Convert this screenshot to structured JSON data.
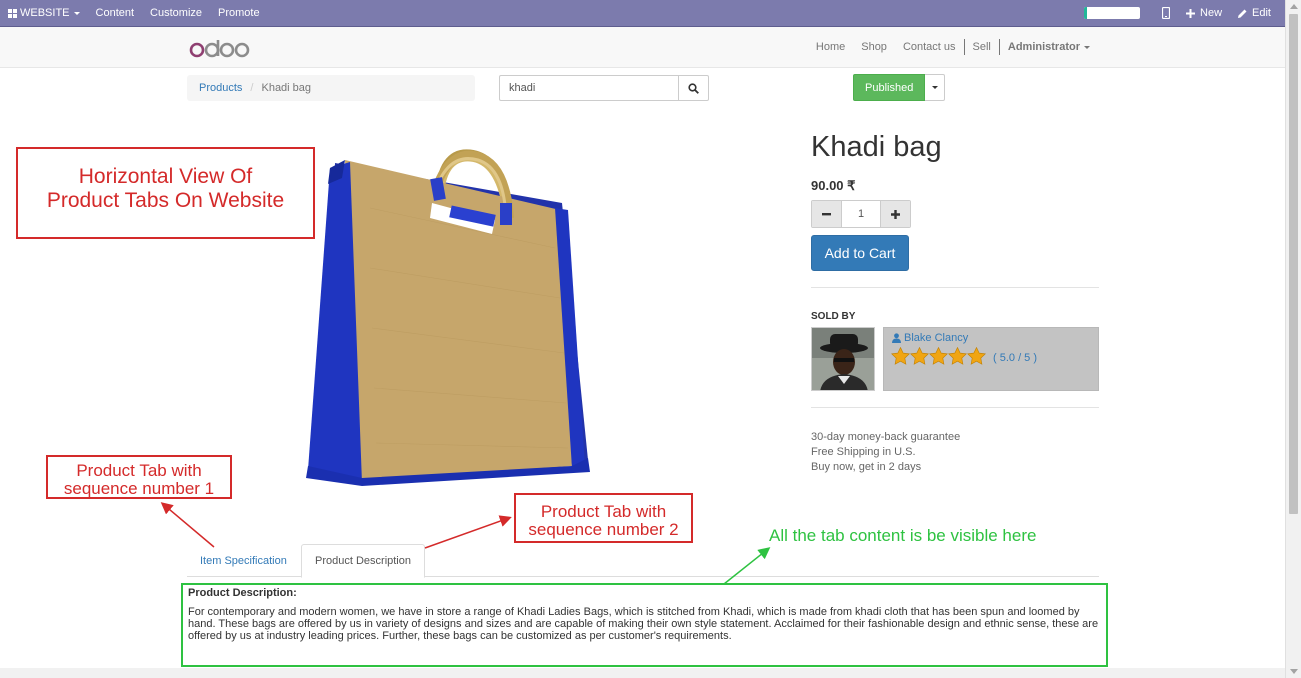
{
  "adminbar": {
    "website_label": "WEBSITE",
    "content_label": "Content",
    "customize_label": "Customize",
    "promote_label": "Promote",
    "new_label": "New",
    "edit_label": "Edit",
    "progress_fraction": 0.05
  },
  "navbar": {
    "logo_text": "odoo",
    "links": [
      "Home",
      "Shop",
      "Contact us",
      "Sell"
    ],
    "user_label": "Administrator"
  },
  "breadcrumb": {
    "parent": "Products",
    "current": "Khadi bag"
  },
  "search": {
    "value": "khadi"
  },
  "publish": {
    "label": "Published"
  },
  "product": {
    "name": "Khadi bag",
    "price": "90.00 ₹",
    "quantity": "1",
    "add_to_cart": "Add to Cart",
    "sold_by_label": "SOLD BY",
    "seller_name": "Blake Clancy",
    "rating_text": "( 5.0 / 5 )",
    "rating_value": 5,
    "info_lines": [
      "30-day money-back guarantee",
      "Free Shipping in U.S.",
      "Buy now, get in 2 days"
    ]
  },
  "annotations": {
    "horizontal_view": [
      "Horizontal View Of",
      "Product Tabs On Website"
    ],
    "tab_seq1": [
      "Product Tab with",
      "sequence number 1"
    ],
    "tab_seq2": [
      "Product Tab with",
      "sequence number 2"
    ],
    "content_note": "All the tab content is be visible here"
  },
  "tabs": {
    "tab1_label": "Item Specification",
    "tab2_label": "Product Description",
    "content_title": "Product Description:",
    "content_body": "For contemporary and modern women, we have in store a range of Khadi Ladies Bags, which is stitched from Khadi, which is made from khadi cloth that has been spun and loomed by hand. These bags are offered by us in variety of designs and sizes and are capable of making their own style statement. Acclaimed for their fashionable design and ethnic sense, these are offered by us at industry leading prices. Further, these bags can be customized as per customer's requirements."
  },
  "colors": {
    "adminbar": "#7c7bad",
    "primary": "#337ab7",
    "published": "#5cb85c",
    "annotation_red": "#d42a2a",
    "annotation_green": "#2ec241",
    "star": "#f0a513"
  },
  "icons": [
    "grid-icon",
    "caret-down-icon",
    "mobile-icon",
    "plus-icon",
    "pencil-icon",
    "search-icon",
    "user-icon",
    "star-icon",
    "minus-icon"
  ]
}
